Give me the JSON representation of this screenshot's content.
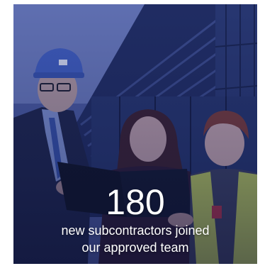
{
  "stat": {
    "number": "180",
    "caption_line1": "new subcontractors joined",
    "caption_line2": "our approved team"
  },
  "colors": {
    "overlay_tint": "#2a3a8a",
    "text": "#ffffff"
  }
}
